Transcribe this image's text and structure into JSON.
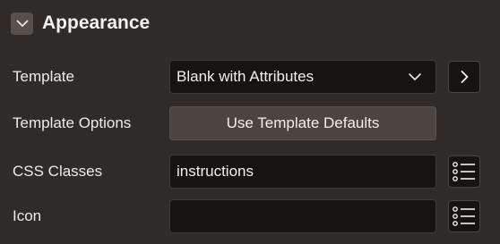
{
  "section": {
    "title": "Appearance",
    "toggle_icon": "chevron-down-icon"
  },
  "template": {
    "label": "Template",
    "value": "Blank with Attributes",
    "dropdown_icon": "chevron-down-icon",
    "goto_icon": "chevron-right-icon"
  },
  "template_options": {
    "label": "Template Options",
    "button_label": "Use Template Defaults"
  },
  "css_classes": {
    "label": "CSS Classes",
    "value": "instructions",
    "picker_icon": "list-icon"
  },
  "icon": {
    "label": "Icon",
    "value": "",
    "picker_icon": "list-icon"
  },
  "colors": {
    "background": "#2f2b29",
    "field": "#161413",
    "button": "#4a4541",
    "text": "#f2f0ee"
  }
}
